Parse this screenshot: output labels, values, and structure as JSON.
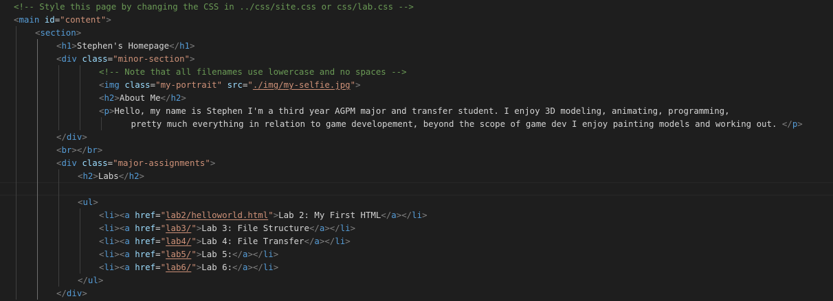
{
  "editor": {
    "language": "html",
    "colors": {
      "background": "#1e1e1e",
      "comment": "#6a9955",
      "bracket": "#808080",
      "tag": "#569cd6",
      "attribute": "#9cdcfe",
      "string": "#ce9178",
      "text": "#d4d4d4"
    },
    "lines": [
      {
        "id": "l1",
        "indent": 0,
        "guides": 0,
        "tokens": [
          {
            "t": "comment",
            "v": "<!-- Style this page by changing the CSS in ../css/site.css or css/lab.css -->"
          }
        ]
      },
      {
        "id": "l2",
        "indent": 0,
        "guides": 0,
        "tokens": [
          {
            "t": "bracket",
            "v": "<"
          },
          {
            "t": "tag",
            "v": "main"
          },
          {
            "t": "text",
            "v": " "
          },
          {
            "t": "attr",
            "v": "id"
          },
          {
            "t": "eq",
            "v": "="
          },
          {
            "t": "str",
            "v": "\"content\""
          },
          {
            "t": "bracket",
            "v": ">"
          }
        ]
      },
      {
        "id": "l3",
        "indent": 1,
        "guides": 1,
        "tokens": [
          {
            "t": "bracket",
            "v": "<"
          },
          {
            "t": "tag",
            "v": "section"
          },
          {
            "t": "bracket",
            "v": ">"
          }
        ]
      },
      {
        "id": "l4",
        "indent": 2,
        "guides": 2,
        "tokens": [
          {
            "t": "bracket",
            "v": "<"
          },
          {
            "t": "tag",
            "v": "h1"
          },
          {
            "t": "bracket",
            "v": ">"
          },
          {
            "t": "text",
            "v": "Stephen's Homepage"
          },
          {
            "t": "bracket",
            "v": "</"
          },
          {
            "t": "tag",
            "v": "h1"
          },
          {
            "t": "bracket",
            "v": ">"
          }
        ]
      },
      {
        "id": "l5",
        "indent": 2,
        "guides": 2,
        "tokens": [
          {
            "t": "bracket",
            "v": "<"
          },
          {
            "t": "tag",
            "v": "div"
          },
          {
            "t": "text",
            "v": " "
          },
          {
            "t": "attr",
            "v": "class"
          },
          {
            "t": "eq",
            "v": "="
          },
          {
            "t": "str",
            "v": "\"minor-section\""
          },
          {
            "t": "bracket",
            "v": ">"
          }
        ]
      },
      {
        "id": "l6",
        "indent": 4,
        "guides": 4,
        "tokens": [
          {
            "t": "comment",
            "v": "<!-- Note that all filenames use lowercase and no spaces -->"
          }
        ]
      },
      {
        "id": "l7",
        "indent": 4,
        "guides": 4,
        "tokens": [
          {
            "t": "bracket",
            "v": "<"
          },
          {
            "t": "tag",
            "v": "img"
          },
          {
            "t": "text",
            "v": " "
          },
          {
            "t": "attr",
            "v": "class"
          },
          {
            "t": "eq",
            "v": "="
          },
          {
            "t": "str",
            "v": "\"my-portrait\""
          },
          {
            "t": "text",
            "v": " "
          },
          {
            "t": "attr",
            "v": "src"
          },
          {
            "t": "eq",
            "v": "="
          },
          {
            "t": "str",
            "v": "\""
          },
          {
            "t": "link",
            "v": "./img/my-selfie.jpg"
          },
          {
            "t": "str",
            "v": "\""
          },
          {
            "t": "bracket",
            "v": ">"
          }
        ]
      },
      {
        "id": "l8",
        "indent": 4,
        "guides": 4,
        "tokens": [
          {
            "t": "bracket",
            "v": "<"
          },
          {
            "t": "tag",
            "v": "h2"
          },
          {
            "t": "bracket",
            "v": ">"
          },
          {
            "t": "text",
            "v": "About Me"
          },
          {
            "t": "bracket",
            "v": "</"
          },
          {
            "t": "tag",
            "v": "h2"
          },
          {
            "t": "bracket",
            "v": ">"
          }
        ]
      },
      {
        "id": "l9",
        "indent": 4,
        "guides": 4,
        "tokens": [
          {
            "t": "bracket",
            "v": "<"
          },
          {
            "t": "tag",
            "v": "p"
          },
          {
            "t": "bracket",
            "v": ">"
          },
          {
            "t": "text",
            "v": "Hello, my name is Stephen I'm a third year AGPM major and transfer student. I enjoy 3D modeling, animating, programming,"
          }
        ]
      },
      {
        "id": "l10",
        "indent": 5.5,
        "guides": 5,
        "tokens": [
          {
            "t": "text",
            "v": "pretty much everything in relation to game developement, beyond the scope of game dev I enjoy painting models and working out. "
          },
          {
            "t": "bracket",
            "v": "</"
          },
          {
            "t": "tag",
            "v": "p"
          },
          {
            "t": "bracket",
            "v": ">"
          }
        ]
      },
      {
        "id": "l11",
        "indent": 2,
        "guides": 2,
        "tokens": [
          {
            "t": "bracket",
            "v": "</"
          },
          {
            "t": "tag",
            "v": "div"
          },
          {
            "t": "bracket",
            "v": ">"
          }
        ]
      },
      {
        "id": "l12",
        "indent": 2,
        "guides": 2,
        "tokens": [
          {
            "t": "bracket",
            "v": "<"
          },
          {
            "t": "tag",
            "v": "br"
          },
          {
            "t": "bracket",
            "v": "></"
          },
          {
            "t": "tag",
            "v": "br"
          },
          {
            "t": "bracket",
            "v": ">"
          }
        ]
      },
      {
        "id": "l13",
        "indent": 2,
        "guides": 2,
        "tokens": [
          {
            "t": "bracket",
            "v": "<"
          },
          {
            "t": "tag",
            "v": "div"
          },
          {
            "t": "text",
            "v": " "
          },
          {
            "t": "attr",
            "v": "class"
          },
          {
            "t": "eq",
            "v": "="
          },
          {
            "t": "str",
            "v": "\"major-assignments\""
          },
          {
            "t": "bracket",
            "v": ">"
          }
        ]
      },
      {
        "id": "l14",
        "indent": 3,
        "guides": 3,
        "tokens": [
          {
            "t": "bracket",
            "v": "<"
          },
          {
            "t": "tag",
            "v": "h2"
          },
          {
            "t": "bracket",
            "v": ">"
          },
          {
            "t": "text",
            "v": "Labs"
          },
          {
            "t": "bracket",
            "v": "</"
          },
          {
            "t": "tag",
            "v": "h2"
          },
          {
            "t": "bracket",
            "v": ">"
          }
        ]
      },
      {
        "id": "l15",
        "indent": 0,
        "guides": 3,
        "current": true,
        "tokens": []
      },
      {
        "id": "l16",
        "indent": 3,
        "guides": 3,
        "tokens": [
          {
            "t": "bracket",
            "v": "<"
          },
          {
            "t": "tag",
            "v": "ul"
          },
          {
            "t": "bracket",
            "v": ">"
          }
        ]
      },
      {
        "id": "l17",
        "indent": 4,
        "guides": 4,
        "tokens": [
          {
            "t": "bracket",
            "v": "<"
          },
          {
            "t": "tag",
            "v": "li"
          },
          {
            "t": "bracket",
            "v": "><"
          },
          {
            "t": "tag",
            "v": "a"
          },
          {
            "t": "text",
            "v": " "
          },
          {
            "t": "attr",
            "v": "href"
          },
          {
            "t": "eq",
            "v": "="
          },
          {
            "t": "str",
            "v": "\""
          },
          {
            "t": "link",
            "v": "lab2/helloworld.html"
          },
          {
            "t": "str",
            "v": "\""
          },
          {
            "t": "bracket",
            "v": ">"
          },
          {
            "t": "text",
            "v": "Lab 2: My First HTML"
          },
          {
            "t": "bracket",
            "v": "</"
          },
          {
            "t": "tag",
            "v": "a"
          },
          {
            "t": "bracket",
            "v": "></"
          },
          {
            "t": "tag",
            "v": "li"
          },
          {
            "t": "bracket",
            "v": ">"
          }
        ]
      },
      {
        "id": "l18",
        "indent": 4,
        "guides": 4,
        "tokens": [
          {
            "t": "bracket",
            "v": "<"
          },
          {
            "t": "tag",
            "v": "li"
          },
          {
            "t": "bracket",
            "v": "><"
          },
          {
            "t": "tag",
            "v": "a"
          },
          {
            "t": "text",
            "v": " "
          },
          {
            "t": "attr",
            "v": "href"
          },
          {
            "t": "eq",
            "v": "="
          },
          {
            "t": "str",
            "v": "\""
          },
          {
            "t": "link",
            "v": "lab3/"
          },
          {
            "t": "str",
            "v": "\""
          },
          {
            "t": "bracket",
            "v": ">"
          },
          {
            "t": "text",
            "v": "Lab 3: File Structure"
          },
          {
            "t": "bracket",
            "v": "</"
          },
          {
            "t": "tag",
            "v": "a"
          },
          {
            "t": "bracket",
            "v": "></"
          },
          {
            "t": "tag",
            "v": "li"
          },
          {
            "t": "bracket",
            "v": ">"
          }
        ]
      },
      {
        "id": "l19",
        "indent": 4,
        "guides": 4,
        "tokens": [
          {
            "t": "bracket",
            "v": "<"
          },
          {
            "t": "tag",
            "v": "li"
          },
          {
            "t": "bracket",
            "v": "><"
          },
          {
            "t": "tag",
            "v": "a"
          },
          {
            "t": "text",
            "v": " "
          },
          {
            "t": "attr",
            "v": "href"
          },
          {
            "t": "eq",
            "v": "="
          },
          {
            "t": "str",
            "v": "\""
          },
          {
            "t": "link",
            "v": "lab4/"
          },
          {
            "t": "str",
            "v": "\""
          },
          {
            "t": "bracket",
            "v": ">"
          },
          {
            "t": "text",
            "v": "Lab 4: File Transfer"
          },
          {
            "t": "bracket",
            "v": "</"
          },
          {
            "t": "tag",
            "v": "a"
          },
          {
            "t": "bracket",
            "v": "></"
          },
          {
            "t": "tag",
            "v": "li"
          },
          {
            "t": "bracket",
            "v": ">"
          }
        ]
      },
      {
        "id": "l20",
        "indent": 4,
        "guides": 4,
        "tokens": [
          {
            "t": "bracket",
            "v": "<"
          },
          {
            "t": "tag",
            "v": "li"
          },
          {
            "t": "bracket",
            "v": "><"
          },
          {
            "t": "tag",
            "v": "a"
          },
          {
            "t": "text",
            "v": " "
          },
          {
            "t": "attr",
            "v": "href"
          },
          {
            "t": "eq",
            "v": "="
          },
          {
            "t": "str",
            "v": "\""
          },
          {
            "t": "link",
            "v": "lab5/"
          },
          {
            "t": "str",
            "v": "\""
          },
          {
            "t": "bracket",
            "v": ">"
          },
          {
            "t": "text",
            "v": "Lab 5:"
          },
          {
            "t": "bracket",
            "v": "</"
          },
          {
            "t": "tag",
            "v": "a"
          },
          {
            "t": "bracket",
            "v": "></"
          },
          {
            "t": "tag",
            "v": "li"
          },
          {
            "t": "bracket",
            "v": ">"
          }
        ]
      },
      {
        "id": "l21",
        "indent": 4,
        "guides": 4,
        "tokens": [
          {
            "t": "bracket",
            "v": "<"
          },
          {
            "t": "tag",
            "v": "li"
          },
          {
            "t": "bracket",
            "v": "><"
          },
          {
            "t": "tag",
            "v": "a"
          },
          {
            "t": "text",
            "v": " "
          },
          {
            "t": "attr",
            "v": "href"
          },
          {
            "t": "eq",
            "v": "="
          },
          {
            "t": "str",
            "v": "\""
          },
          {
            "t": "link",
            "v": "lab6/"
          },
          {
            "t": "str",
            "v": "\""
          },
          {
            "t": "bracket",
            "v": ">"
          },
          {
            "t": "text",
            "v": "Lab 6:"
          },
          {
            "t": "bracket",
            "v": "</"
          },
          {
            "t": "tag",
            "v": "a"
          },
          {
            "t": "bracket",
            "v": "></"
          },
          {
            "t": "tag",
            "v": "li"
          },
          {
            "t": "bracket",
            "v": ">"
          }
        ]
      },
      {
        "id": "l22",
        "indent": 3,
        "guides": 3,
        "tokens": [
          {
            "t": "bracket",
            "v": "</"
          },
          {
            "t": "tag",
            "v": "ul"
          },
          {
            "t": "bracket",
            "v": ">"
          }
        ]
      },
      {
        "id": "l23",
        "indent": 2,
        "guides": 2,
        "tokens": [
          {
            "t": "bracket",
            "v": "</"
          },
          {
            "t": "tag",
            "v": "div"
          },
          {
            "t": "bracket",
            "v": ">"
          }
        ]
      }
    ]
  }
}
